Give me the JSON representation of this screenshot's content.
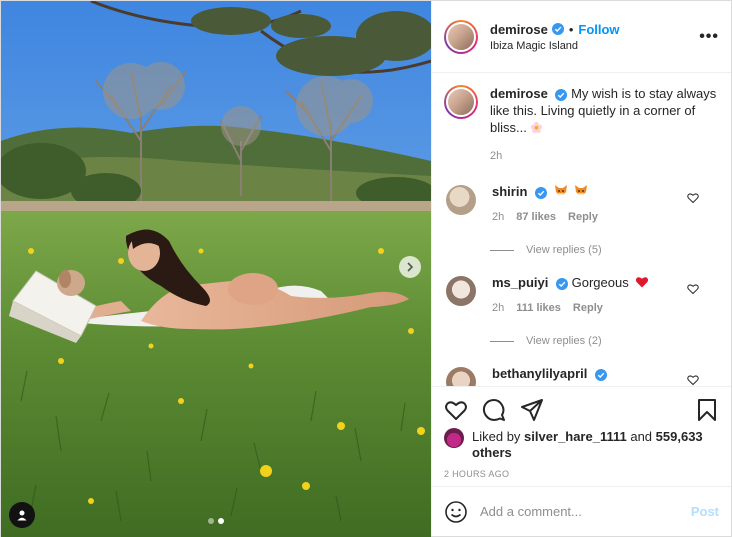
{
  "header": {
    "username": "demirose",
    "separator": "•",
    "follow_label": "Follow",
    "location": "Ibiza Magic Island",
    "more_label": "•••"
  },
  "caption": {
    "username": "demirose",
    "text": "My wish is to stay always like this. Living quietly in a corner of bliss...",
    "time": "2h",
    "emoji_icon": "flower-icon"
  },
  "comments": [
    {
      "username": "shirin",
      "text": "",
      "emoji_icon": "fox-face-icon",
      "time": "2h",
      "likes": "87 likes",
      "reply_label": "Reply",
      "view_replies": "View replies (5)"
    },
    {
      "username": "ms_puiyi",
      "text": "Gorgeous",
      "emoji_icon": "red-heart-icon",
      "time": "2h",
      "likes": "111 likes",
      "reply_label": "Reply",
      "view_replies": "View replies (2)"
    },
    {
      "username": "bethanylilyapril",
      "text": ""
    }
  ],
  "likes": {
    "prefix": "Liked by",
    "user": "silver_hare_1111",
    "and_label": "and",
    "others": "559,633 others"
  },
  "time_ago": "2 HOURS AGO",
  "add_comment": {
    "placeholder": "Add a comment...",
    "post_label": "Post"
  },
  "colors": {
    "accent": "#0095f6",
    "verified": "#3897f0",
    "post_disabled": "#b2dffc",
    "muted": "#8e8e8e"
  },
  "carousel": {
    "total": 2,
    "current": 2
  }
}
